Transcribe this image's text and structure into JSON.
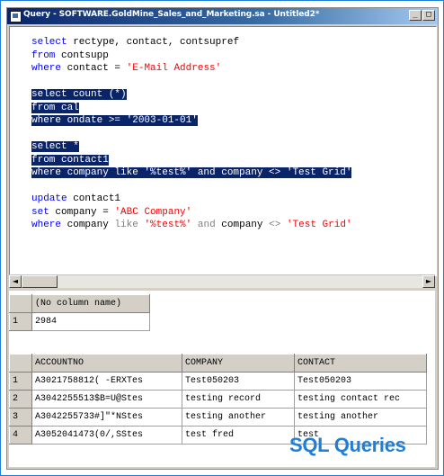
{
  "window": {
    "title": "Query - SOFTWARE.GoldMine_Sales_and_Marketing.sa - Untitled2*",
    "buttons": [
      "_",
      "□"
    ]
  },
  "editor": {
    "lines": [
      [
        {
          "t": "select",
          "c": "kw"
        },
        {
          "t": " rectype, contact, contsupref",
          "c": ""
        }
      ],
      [
        {
          "t": "from",
          "c": "kw"
        },
        {
          "t": " contsupp",
          "c": ""
        }
      ],
      [
        {
          "t": "where",
          "c": "kw"
        },
        {
          "t": " contact = ",
          "c": ""
        },
        {
          "t": "'E-Mail Address'",
          "c": "str"
        }
      ],
      [],
      [
        {
          "t": "select count (*)",
          "c": "sel"
        }
      ],
      [
        {
          "t": "from cal",
          "c": "sel"
        }
      ],
      [
        {
          "t": "where ondate >= '2003-01-01'",
          "c": "sel"
        }
      ],
      [],
      [
        {
          "t": "select *",
          "c": "sel"
        }
      ],
      [
        {
          "t": "from contact1",
          "c": "sel"
        }
      ],
      [
        {
          "t": "where company like '%test%' and company <> 'Test Grid'",
          "c": "sel"
        }
      ],
      [],
      [
        {
          "t": "update",
          "c": "kw"
        },
        {
          "t": " contact1",
          "c": ""
        }
      ],
      [
        {
          "t": "set",
          "c": "kw"
        },
        {
          "t": " company = ",
          "c": ""
        },
        {
          "t": "'ABC Company'",
          "c": "str"
        }
      ],
      [
        {
          "t": "where",
          "c": "kw"
        },
        {
          "t": " company ",
          "c": ""
        },
        {
          "t": "like",
          "c": "gry"
        },
        {
          "t": " ",
          "c": ""
        },
        {
          "t": "'%test%'",
          "c": "str"
        },
        {
          "t": " ",
          "c": ""
        },
        {
          "t": "and",
          "c": "gry"
        },
        {
          "t": " company ",
          "c": ""
        },
        {
          "t": "<>",
          "c": "gry"
        },
        {
          "t": " ",
          "c": ""
        },
        {
          "t": "'Test Grid'",
          "c": "str"
        }
      ]
    ]
  },
  "scrollbar": {
    "left": "◄",
    "right": "►"
  },
  "result1": {
    "header": "(No column name)",
    "rows": [
      {
        "n": "1",
        "v": "2984"
      }
    ]
  },
  "result2": {
    "headers": [
      "ACCOUNTNO",
      "COMPANY",
      "CONTACT"
    ],
    "rows": [
      {
        "n": "1",
        "a": "A3021758812( -ERXTes",
        "b": "Test050203",
        "c": "Test050203"
      },
      {
        "n": "2",
        "a": "A3042255513$B=U@Stes",
        "b": "testing record",
        "c": "testing contact rec"
      },
      {
        "n": "3",
        "a": "A3042255733#]\"*NStes",
        "b": "testing another",
        "c": "testing another"
      },
      {
        "n": "4",
        "a": "A3052041473(0/,SStes",
        "b": "test fred",
        "c": "test"
      }
    ]
  },
  "logo": "SQL Queries"
}
